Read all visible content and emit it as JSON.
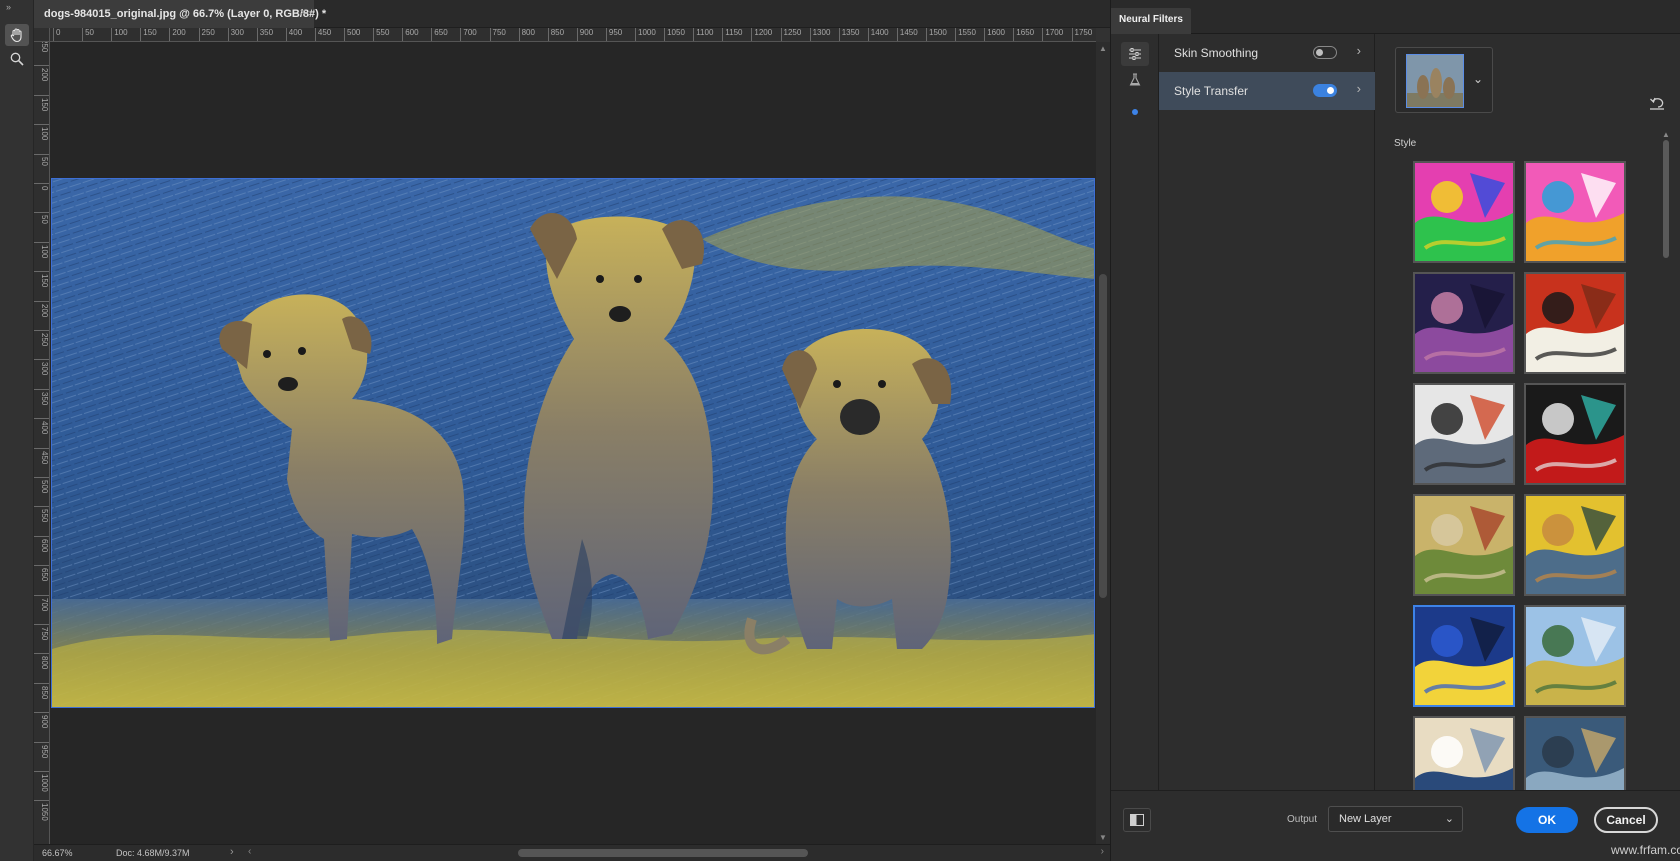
{
  "document": {
    "tab_title": "dogs-984015_original.jpg @ 66.7% (Layer 0, RGB/8#) *",
    "close_glyph": "×",
    "collapse_glyph": "»"
  },
  "rulers": {
    "horizontal": [
      "0",
      "50",
      "100",
      "150",
      "200",
      "250",
      "300",
      "350",
      "400",
      "450",
      "500",
      "550",
      "600",
      "650",
      "700",
      "750",
      "800",
      "850",
      "900",
      "950",
      "1000",
      "1050",
      "1100",
      "1150",
      "1200",
      "1250",
      "1300",
      "1350",
      "1400",
      "1450",
      "1500",
      "1550",
      "1600",
      "1650",
      "1700",
      "1750"
    ],
    "vertical": [
      "250",
      "200",
      "150",
      "100",
      "50",
      "0",
      "50",
      "100",
      "150",
      "200",
      "250",
      "300",
      "350",
      "400",
      "450",
      "500",
      "550",
      "600",
      "650",
      "700",
      "750",
      "800",
      "850",
      "900",
      "950",
      "1000",
      "1050"
    ]
  },
  "tools": [
    {
      "name": "hand-tool",
      "icon": "hand-icon",
      "active": true
    },
    {
      "name": "zoom-tool",
      "icon": "magnifier-icon",
      "active": false
    }
  ],
  "status": {
    "zoom": "66.67%",
    "doc": "Doc: 4.68M/9.37M",
    "chevron": "›"
  },
  "neural_filters": {
    "panel_title": "Neural Filters",
    "filters": [
      {
        "label": "Skin Smoothing",
        "enabled": false,
        "chevron": "›"
      },
      {
        "label": "Style Transfer",
        "enabled": true,
        "chevron": "›"
      }
    ],
    "style_section_label": "Style",
    "styles": [
      {
        "icon": "abstract-face-style",
        "colors": [
          "#e43fb0",
          "#2ec24d",
          "#f2d321",
          "#2d4fe0"
        ],
        "selected": false
      },
      {
        "icon": "colorful-portrait-style",
        "colors": [
          "#f25ab8",
          "#f0a12b",
          "#27a3d8",
          "#ffffff"
        ],
        "selected": false
      },
      {
        "icon": "dark-figure-style",
        "colors": [
          "#241f4a",
          "#8c4a9e",
          "#c77fa6",
          "#171331"
        ],
        "selected": false
      },
      {
        "icon": "cubist-style",
        "colors": [
          "#c8321d",
          "#f2efe4",
          "#1a1a1a",
          "#7a2a18"
        ],
        "selected": false
      },
      {
        "icon": "gray-cubist-style",
        "colors": [
          "#e6e6e6",
          "#5e6a7a",
          "#262626",
          "#d04a2a"
        ],
        "selected": false
      },
      {
        "icon": "tattoo-style",
        "colors": [
          "#1a1a1a",
          "#c21a1a",
          "#e6e6e6",
          "#2fb3a8"
        ],
        "selected": false
      },
      {
        "icon": "village-painting-style",
        "colors": [
          "#c9b36a",
          "#6e8a3a",
          "#d8c9a2",
          "#a7442b"
        ],
        "selected": false
      },
      {
        "icon": "van-gogh-portrait-style",
        "colors": [
          "#e3c12f",
          "#4d6d8a",
          "#c7893f",
          "#2f4a3e"
        ],
        "selected": false
      },
      {
        "icon": "starry-night-style",
        "colors": [
          "#1c3a8a",
          "#f2d33a",
          "#2b5ad1",
          "#101c3a"
        ],
        "selected": true
      },
      {
        "icon": "wheat-field-style",
        "colors": [
          "#9cc2e6",
          "#c9b34a",
          "#3a6b3a",
          "#e6eef6"
        ],
        "selected": false
      },
      {
        "icon": "great-wave-style",
        "colors": [
          "#e8dcc2",
          "#2a4a7a",
          "#ffffff",
          "#7a93b0"
        ],
        "selected": false
      },
      {
        "icon": "dancers-style",
        "colors": [
          "#3a5a7a",
          "#8aa8c0",
          "#2a3a4a",
          "#c7a76a"
        ],
        "selected": false
      }
    ],
    "output_label": "Output",
    "output_value": "New Layer",
    "dropdown_glyph": "⌄",
    "ok_label": "OK",
    "cancel_label": "Cancel"
  },
  "watermark": "www.frfam.com",
  "colors": {
    "accent": "#1473e6",
    "selection": "#3d83e8",
    "panel_bg": "#2d2d2d",
    "canvas_bg": "#262626"
  }
}
